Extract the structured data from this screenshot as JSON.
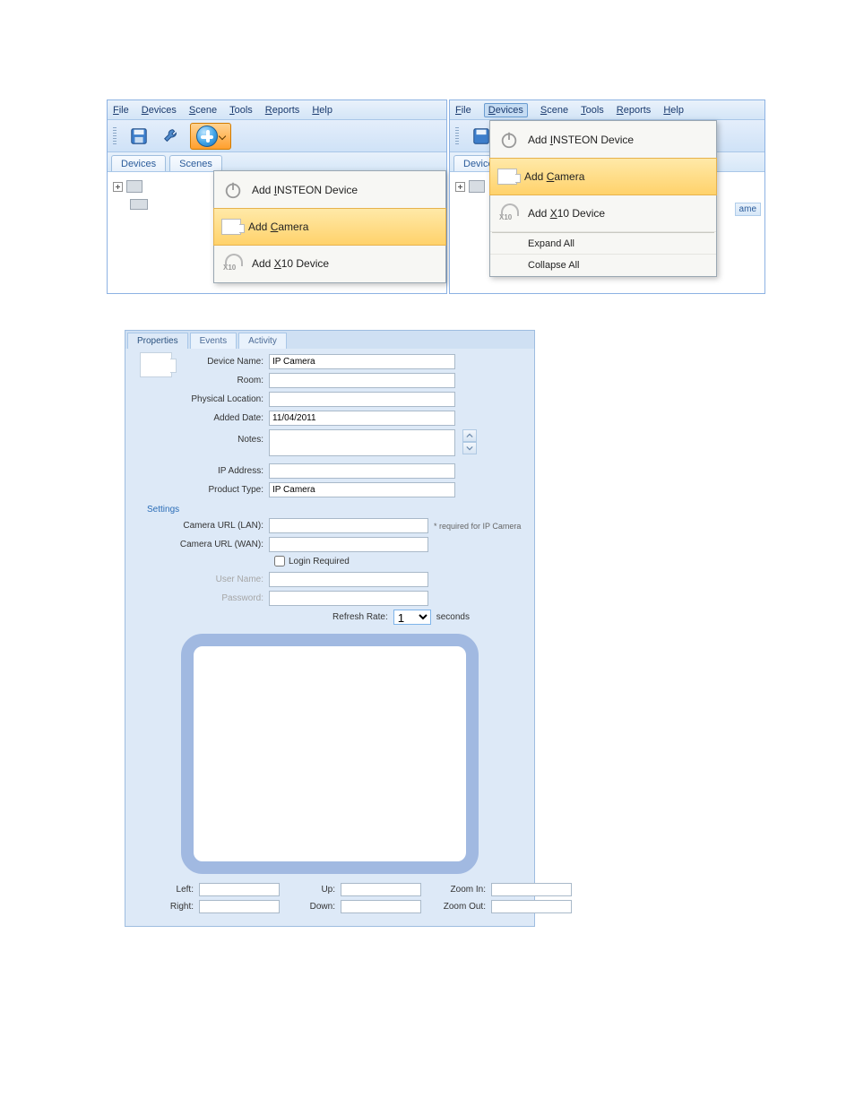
{
  "menubar": {
    "file": "File",
    "devices": "Devices",
    "scene": "Scene",
    "tools": "Tools",
    "reports": "Reports",
    "help": "Help"
  },
  "tabs": {
    "devices": "Devices",
    "scenes": "Scenes"
  },
  "dropdown_add": {
    "insteon": "Add INSTEON Device",
    "camera": "Add Camera",
    "x10": "Add X10 Device"
  },
  "devices_menu": {
    "insteon": "Add INSTEON Device",
    "camera": "Add Camera",
    "x10": "Add X10 Device",
    "expand": "Expand All",
    "collapse": "Collapse All"
  },
  "column_header": "ame",
  "properties": {
    "tabs": {
      "properties": "Properties",
      "events": "Events",
      "activity": "Activity"
    },
    "labels": {
      "device_name": "Device Name:",
      "room": "Room:",
      "physical_location": "Physical Location:",
      "added_date": "Added Date:",
      "notes": "Notes:",
      "ip_address": "IP Address:",
      "product_type": "Product Type:",
      "settings": "Settings",
      "camera_url_lan": "Camera URL (LAN):",
      "camera_url_wan": "Camera URL (WAN):",
      "login_required": "Login Required",
      "user_name": "User Name:",
      "password": "Password:",
      "refresh_rate": "Refresh Rate:",
      "seconds": "seconds",
      "required_note": "* required for IP Camera",
      "left": "Left:",
      "right": "Right:",
      "up": "Up:",
      "down": "Down:",
      "zoom_in": "Zoom In:",
      "zoom_out": "Zoom Out:"
    },
    "values": {
      "device_name": "IP Camera",
      "room": "",
      "physical_location": "",
      "added_date": "11/04/2011",
      "notes": "",
      "ip_address": "",
      "product_type": "IP Camera",
      "camera_url_lan": "",
      "camera_url_wan": "",
      "login_required": false,
      "user_name": "",
      "password": "",
      "refresh_rate": "1",
      "left": "",
      "right": "",
      "up": "",
      "down": "",
      "zoom_in": "",
      "zoom_out": ""
    }
  }
}
